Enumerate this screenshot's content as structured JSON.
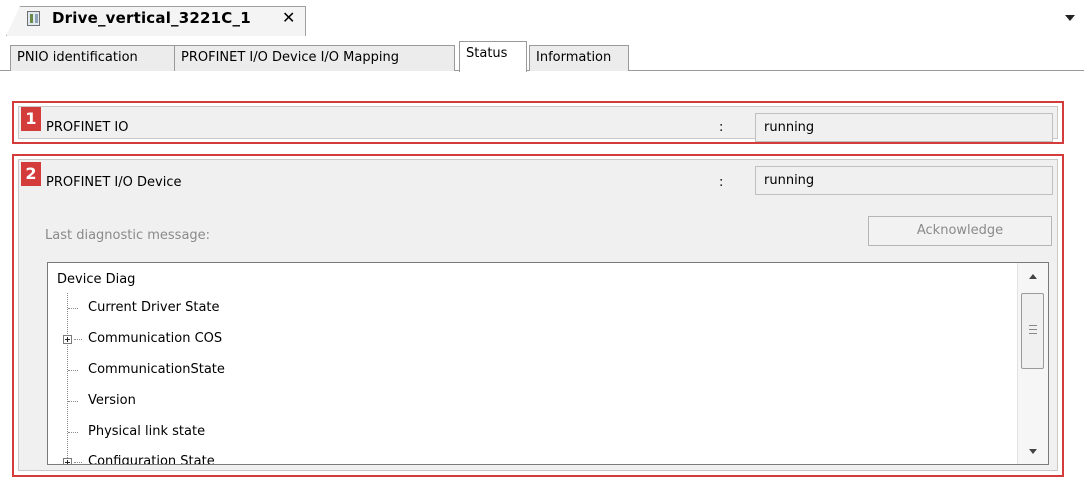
{
  "document_tab": {
    "title": "Drive_vertical_3221C_1",
    "close_glyph": "✕",
    "icon": "device-icon"
  },
  "tabs": [
    {
      "label": "PNIO identification",
      "active": false
    },
    {
      "label": "PROFINET I/O Device I/O Mapping",
      "active": false
    },
    {
      "label": "Status",
      "active": true
    },
    {
      "label": "Information",
      "active": false
    }
  ],
  "section1": {
    "badge": "1",
    "label": "PROFINET IO",
    "colon": ":",
    "value": "running"
  },
  "section2": {
    "badge": "2",
    "label": "PROFINET I/O Device",
    "colon": ":",
    "value": "running",
    "diag_label": "Last diagnostic message:",
    "ack_button": "Acknowledge",
    "tree": {
      "root": "Device Diag",
      "items": [
        {
          "label": "Current Driver State",
          "expandable": false
        },
        {
          "label": "Communication COS",
          "expandable": true
        },
        {
          "label": "CommunicationState",
          "expandable": false
        },
        {
          "label": "Version",
          "expandable": false
        },
        {
          "label": "Physical link state",
          "expandable": false
        },
        {
          "label": "Configuration State",
          "expandable": true
        }
      ]
    }
  },
  "colors": {
    "highlight_border": "#d43b3b",
    "panel_bg": "#f0f0f0"
  }
}
